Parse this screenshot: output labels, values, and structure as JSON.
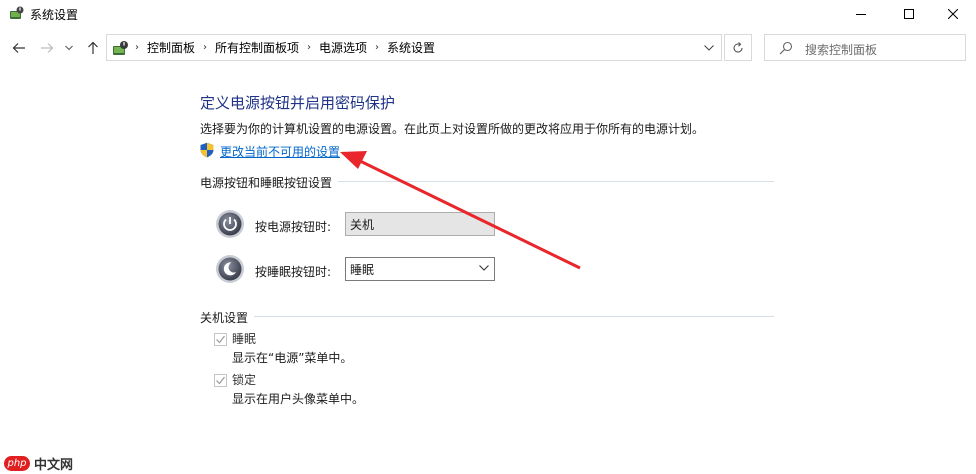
{
  "window": {
    "title": "系统设置",
    "controls": [
      "minimize",
      "maximize",
      "close"
    ]
  },
  "navigation": {
    "breadcrumbs": [
      "控制面板",
      "所有控制面板项",
      "电源选项",
      "系统设置"
    ],
    "search_placeholder": "搜索控制面板"
  },
  "main": {
    "title": "定义电源按钮并启用密码保护",
    "description": "选择要为你的计算机设置的电源设置。在此页上对设置所做的更改将应用于你所有的电源计划。",
    "change_link": "更改当前不可用的设置"
  },
  "buttons_section": {
    "title": "电源按钮和睡眠按钮设置",
    "power_label": "按电源按钮时:",
    "power_value": "关机",
    "sleep_label": "按睡眠按钮时:",
    "sleep_value": "睡眠"
  },
  "shutdown_section": {
    "title": "关机设置",
    "items": [
      {
        "label": "睡眠",
        "description": "显示在“电源”菜单中。",
        "checked": true,
        "enabled": false
      },
      {
        "label": "锁定",
        "description": "显示在用户头像菜单中。",
        "checked": true,
        "enabled": false
      }
    ]
  },
  "watermark": {
    "badge": "php",
    "text": "中文网"
  },
  "colors": {
    "title": "#1e3287",
    "link": "#0066cc",
    "annotation_arrow": "#e8262b"
  }
}
